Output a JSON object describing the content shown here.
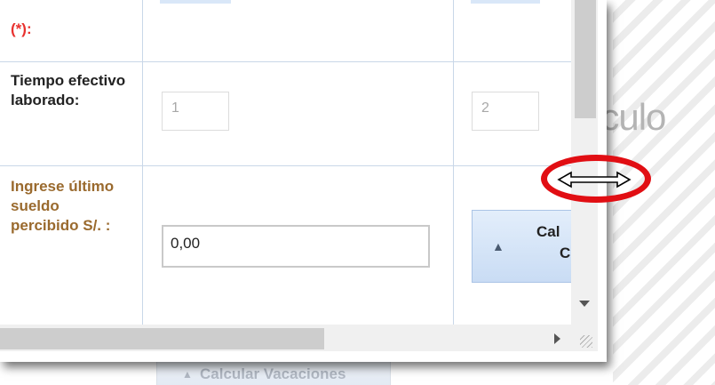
{
  "form": {
    "required_label": "(*):",
    "tiempo_label": "Tiempo efectivo laborado:",
    "tiempo_values": [
      "1",
      "2"
    ],
    "sueldo_label": "Ingrese último sueldo percibido S/. :",
    "sueldo_value": "0,00"
  },
  "calc_button": {
    "line1": "Cal",
    "line2": "C"
  },
  "background": {
    "title_fragment": "lculo",
    "button_label": "Calcular Vacaciones"
  },
  "icons": {
    "resize_cursor": "horizontal-resize-cursor-icon",
    "expand": "chevron-up-icon"
  },
  "colors": {
    "required_red": "#e8322f",
    "label_brown": "#9a6a2e",
    "annotation_red": "#e10e13",
    "button_blue": "#c9dcf4"
  }
}
